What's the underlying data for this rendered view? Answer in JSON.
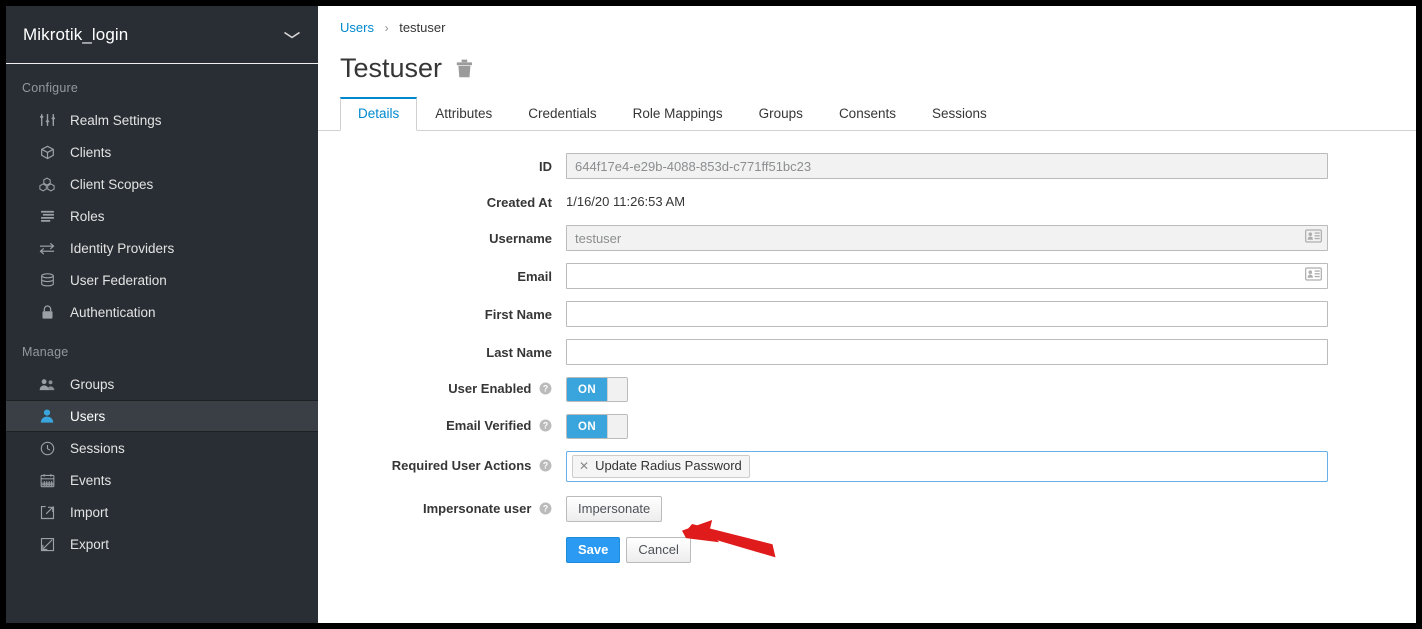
{
  "sidebar": {
    "realm": {
      "name": "Mikrotik_login",
      "chevron": "chevron-down-icon"
    },
    "sections": [
      {
        "label": "Configure",
        "items": [
          {
            "label": "Realm Settings",
            "icon": "sliders-icon",
            "active": false
          },
          {
            "label": "Clients",
            "icon": "cube-icon",
            "active": false
          },
          {
            "label": "Client Scopes",
            "icon": "cubes-icon",
            "active": false
          },
          {
            "label": "Roles",
            "icon": "list-icon",
            "active": false
          },
          {
            "label": "Identity Providers",
            "icon": "exchange-arrows-icon",
            "active": false
          },
          {
            "label": "User Federation",
            "icon": "database-icon",
            "active": false
          },
          {
            "label": "Authentication",
            "icon": "lock-icon",
            "active": false
          }
        ]
      },
      {
        "label": "Manage",
        "items": [
          {
            "label": "Groups",
            "icon": "users-group-icon",
            "active": false
          },
          {
            "label": "Users",
            "icon": "user-icon",
            "active": true
          },
          {
            "label": "Sessions",
            "icon": "clock-icon",
            "active": false
          },
          {
            "label": "Events",
            "icon": "calendar-icon",
            "active": false
          },
          {
            "label": "Import",
            "icon": "import-arrow-icon",
            "active": false
          },
          {
            "label": "Export",
            "icon": "export-arrow-icon",
            "active": false
          }
        ]
      }
    ]
  },
  "breadcrumb": {
    "parent": "Users",
    "separator": "›",
    "current": "testuser"
  },
  "header": {
    "title": "Testuser",
    "delete_icon": "trash-icon"
  },
  "tabs": [
    {
      "label": "Details",
      "active": true
    },
    {
      "label": "Attributes",
      "active": false
    },
    {
      "label": "Credentials",
      "active": false
    },
    {
      "label": "Role Mappings",
      "active": false
    },
    {
      "label": "Groups",
      "active": false
    },
    {
      "label": "Consents",
      "active": false
    },
    {
      "label": "Sessions",
      "active": false
    }
  ],
  "form": {
    "id": {
      "label": "ID",
      "value": "644f17e4-e29b-4088-853d-c771ff51bc23",
      "readonly": true
    },
    "created_at": {
      "label": "Created At",
      "value": "1/16/20 11:26:53 AM"
    },
    "username": {
      "label": "Username",
      "value": "testuser",
      "readonly": true,
      "icon": "contact-card-icon"
    },
    "email": {
      "label": "Email",
      "value": "",
      "placeholder": "",
      "icon": "contact-card-icon"
    },
    "first_name": {
      "label": "First Name",
      "value": "",
      "placeholder": ""
    },
    "last_name": {
      "label": "Last Name",
      "value": "",
      "placeholder": ""
    },
    "user_enabled": {
      "label": "User Enabled",
      "help_icon": "help-circle-icon",
      "state": "ON"
    },
    "email_verified": {
      "label": "Email Verified",
      "help_icon": "help-circle-icon",
      "state": "ON"
    },
    "required_user_actions": {
      "label": "Required User Actions",
      "help_icon": "help-circle-icon",
      "chips": [
        {
          "label": "Update Radius Password",
          "remove_icon": "close-x-icon"
        }
      ]
    },
    "impersonate": {
      "label": "Impersonate user",
      "help_icon": "help-circle-icon",
      "button_label": "Impersonate"
    },
    "actions": {
      "save_label": "Save",
      "cancel_label": "Cancel"
    }
  },
  "annotation": {
    "arrow_icon": "red-arrow-pointer",
    "color": "#e01b1b",
    "points_at": "Impersonate"
  },
  "colors": {
    "sidebar_bg": "#292e34",
    "sidebar_active_bg": "#393f44",
    "accent_blue": "#0088ce",
    "toggle_on": "#39a5dc",
    "primary_button": "#2b9af3",
    "link": "#0088ce",
    "annotation_red": "#e01b1b"
  }
}
